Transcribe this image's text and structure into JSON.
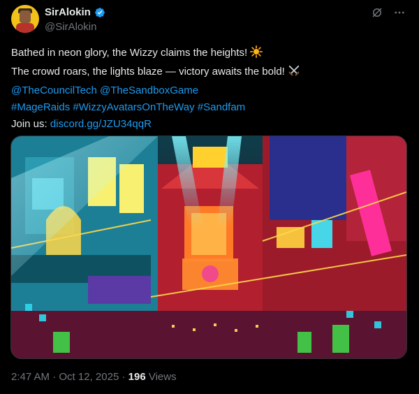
{
  "author": {
    "name": "SirAlokin",
    "handle": "@SirAlokin"
  },
  "post": {
    "line1": "Bathed in neon glory, the Wizzy claims the heights!",
    "line2": "The crowd roars, the lights blaze — victory awaits the bold!",
    "mention1": "@TheCouncilTech",
    "mention2": "@TheSandboxGame",
    "hashtag1": "#MageRaids",
    "hashtag2": "#WizzyAvatarsOnTheWay",
    "hashtag3": "#Sandfam",
    "join_label": "Join us:",
    "join_link": "discord.gg/JZU34qqR"
  },
  "meta": {
    "time": "2:47 AM",
    "separator": "·",
    "date": "Oct 12, 2025",
    "views_count": "196",
    "views_label": "Views"
  },
  "colors": {
    "background": "#000000",
    "text": "#e7e9ea",
    "secondary": "#71767b",
    "link": "#1d9bf0",
    "verified": "#1d9bf0"
  },
  "icons": [
    "verified-badge-icon",
    "grok-icon",
    "more-icon",
    "sun-emoji",
    "crossed-swords-emoji"
  ]
}
